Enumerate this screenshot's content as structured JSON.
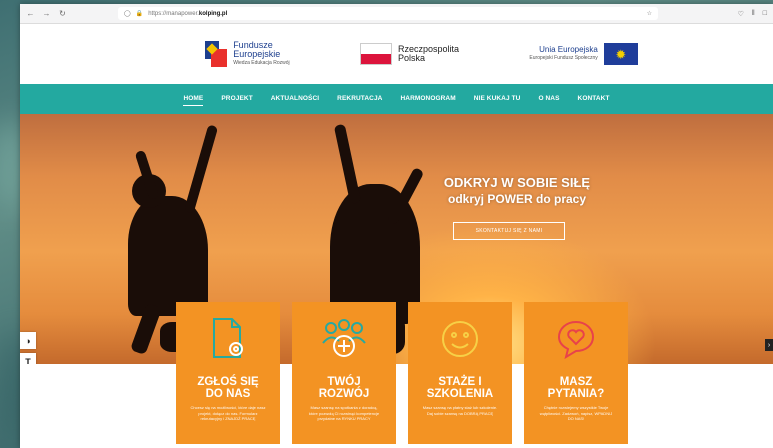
{
  "browser": {
    "url_prefix": "https://manapower.",
    "url_domain": "kolping.pl",
    "back_icon": "arrow-left-icon",
    "forward_icon": "arrow-right-icon",
    "reload_icon": "reload-icon"
  },
  "logos": {
    "fe_line1": "Fundusze",
    "fe_line2": "Europejskie",
    "fe_sub": "Wiedza Edukacja Rozwój",
    "pl_line1": "Rzeczpospolita",
    "pl_line2": "Polska",
    "eu_line1": "Unia Europejska",
    "eu_sub": "Europejski Fundusz Społeczny"
  },
  "nav": {
    "items": [
      "HOME",
      "PROJEKT",
      "AKTUALNOŚCI",
      "REKRUTACJA",
      "HARMONOGRAM",
      "NIE KUKAJ TU",
      "O NAS",
      "KONTAKT"
    ],
    "active": "HOME"
  },
  "hero": {
    "title_line1": "ODKRYJ W SOBIE SIŁĘ",
    "title_line2": "odkryj POWER do pracy",
    "cta": "SKONTAKTUJ SIĘ Z NAMI"
  },
  "cards": [
    {
      "title1": "ZGŁOŚ SIĘ",
      "title2": "DO NAS",
      "text": "Chcesz się na możliwości, które daje nasz projekt, dołącz do nas. Formularz rekrutacyjny i ZNAJDŹ PRACĘ",
      "icon": "document-gear-icon"
    },
    {
      "title1": "TWÓJ",
      "title2": "ROZWÓJ",
      "text": "Masz szansę na spotkania z doradcą, które pozwolą Ci rozwinąć kompetencje przydatne na RYNKU PRACY",
      "icon": "people-plus-icon"
    },
    {
      "title1": "STAŻE I",
      "title2": "SZKOLENIA",
      "text": "Masz szansę na płatny staż lub szkolenie. Daj sobie szansę na DOBRĄ PRACĘ",
      "icon": "smiley-icon"
    },
    {
      "title1": "MASZ",
      "title2": "PYTANIA?",
      "text": "Chętnie rozwiejemy wszystkie Twoje wątpliwości. Zadzwoń, napisz, WPADNIJ DO NAS!",
      "icon": "heart-chat-icon"
    }
  ]
}
